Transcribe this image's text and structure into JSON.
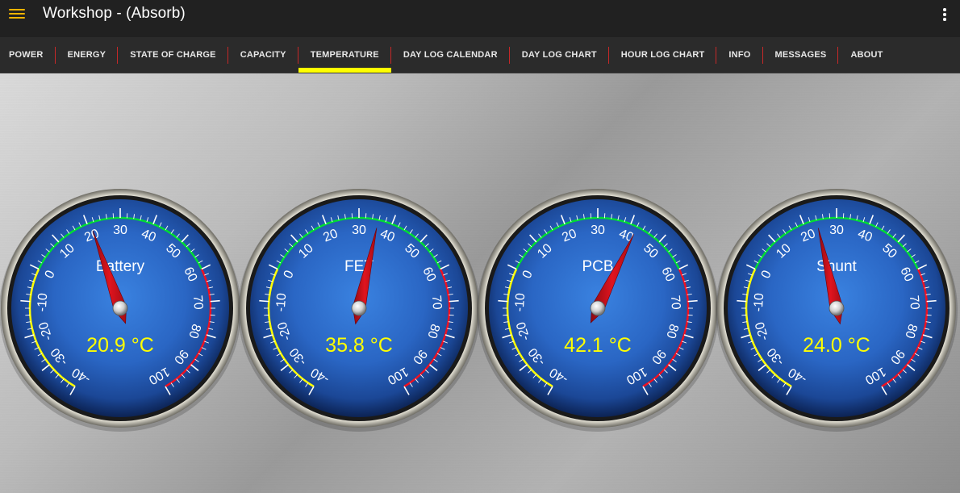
{
  "app": {
    "title": "Workshop - (Absorb)",
    "menu_icon": "hamburger-menu-icon",
    "overflow_icon": "more-vert-icon"
  },
  "tabs": [
    {
      "label": "POWER",
      "active": false
    },
    {
      "label": "ENERGY",
      "active": false
    },
    {
      "label": "STATE OF CHARGE",
      "active": false
    },
    {
      "label": "CAPACITY",
      "active": false
    },
    {
      "label": "TEMPERATURE",
      "active": true
    },
    {
      "label": "DAY LOG CALENDAR",
      "active": false
    },
    {
      "label": "DAY LOG CHART",
      "active": false
    },
    {
      "label": "HOUR LOG CHART",
      "active": false
    },
    {
      "label": "INFO",
      "active": false
    },
    {
      "label": "MESSAGES",
      "active": false
    },
    {
      "label": "ABOUT",
      "active": false
    }
  ],
  "gauge_scale": {
    "min": -40,
    "max": 100,
    "major_step": 10,
    "unit": "°C",
    "ranges": [
      {
        "from": -40,
        "to": 0,
        "color": "#ffff00"
      },
      {
        "from": 0,
        "to": 60,
        "color": "#00dd33"
      },
      {
        "from": 60,
        "to": 100,
        "color": "#ee1122"
      }
    ]
  },
  "gauges": [
    {
      "name": "Battery",
      "value": 20.9,
      "display": "20.9 °C"
    },
    {
      "name": "FET",
      "value": 35.8,
      "display": "35.8 °C"
    },
    {
      "name": "PCB",
      "value": 42.1,
      "display": "42.1 °C"
    },
    {
      "name": "Shunt",
      "value": 24.0,
      "display": "24.0 °C"
    }
  ],
  "colors": {
    "accent": "#ffff00",
    "menu_icon": "#f5b400",
    "tab_separator": "#c62828",
    "needle": "#d0101a",
    "value_text": "#ffff00",
    "dial_blue": "#2d6fd0"
  }
}
